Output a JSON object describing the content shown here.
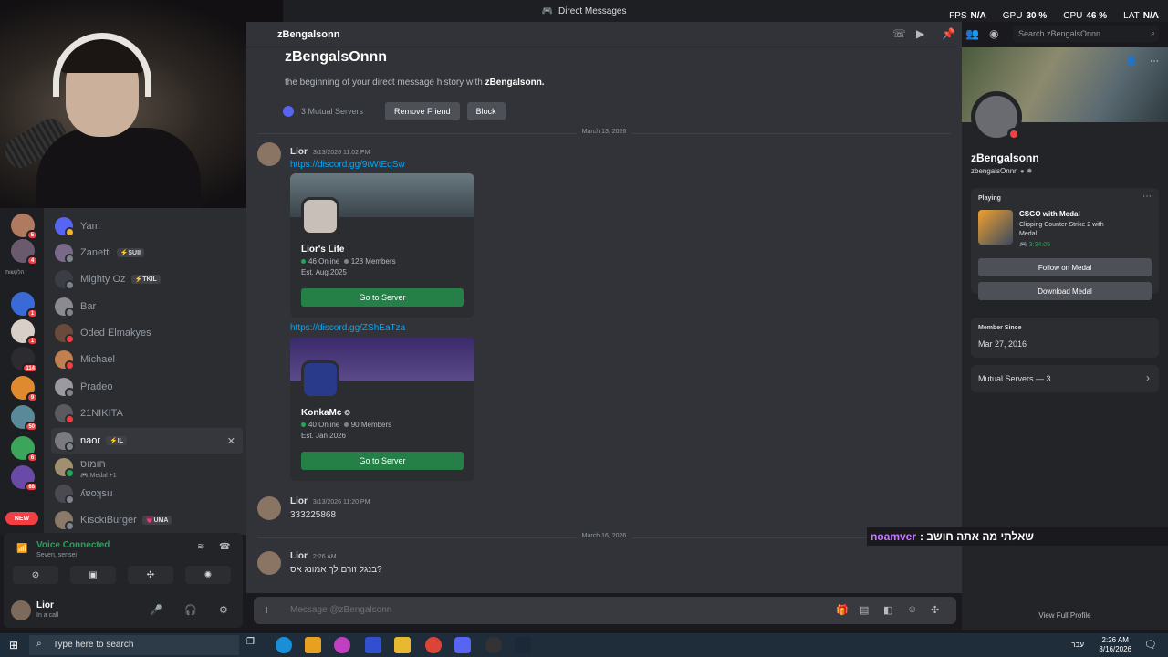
{
  "window": {
    "title": "Direct Messages"
  },
  "perf": [
    {
      "label": "FPS",
      "value": "N/A"
    },
    {
      "label": "GPU",
      "value": "30 %"
    },
    {
      "label": "CPU",
      "value": "46 %"
    },
    {
      "label": "LAT",
      "value": "N/A"
    }
  ],
  "rail": {
    "badges": [
      "5",
      "4",
      "1",
      "1",
      "114",
      "9",
      "50",
      "6",
      "68"
    ],
    "new_label": "NEW",
    "hebrew_label": "הלקשות"
  },
  "dm_list": [
    {
      "name": "Yam",
      "tag": "",
      "sub": ""
    },
    {
      "name": "Zanetti",
      "tag": "⚡SUII",
      "sub": ""
    },
    {
      "name": "Mighty Oz",
      "tag": "⚡TKIL",
      "sub": ""
    },
    {
      "name": "Bar",
      "tag": "",
      "sub": ""
    },
    {
      "name": "Oded Elmakyes",
      "tag": "",
      "sub": ""
    },
    {
      "name": "Michael",
      "tag": "",
      "sub": ""
    },
    {
      "name": "Pradeo",
      "tag": "",
      "sub": ""
    },
    {
      "name": "21NIKITA",
      "tag": "",
      "sub": ""
    },
    {
      "name": "naor",
      "tag": "⚡IL",
      "sub": ""
    },
    {
      "name": "חומוס",
      "tag": "",
      "sub": "🎮 Medal +1"
    },
    {
      "name": "ʎɐoʞsıɹ",
      "tag": "",
      "sub": ""
    },
    {
      "name": "KisckiBurger",
      "tag": "💗UMA",
      "sub": ""
    }
  ],
  "voice": {
    "status": "Voice Connected",
    "channel": "Seven, sensei"
  },
  "user": {
    "name": "Lior",
    "status": "In a call"
  },
  "chat": {
    "header_name": "zBengalsonn",
    "intro_name": "zBengalsOnnn",
    "intro_prefix": "the beginning of your direct message history with",
    "intro_user": "zBengalsonn.",
    "mutual_servers": "3 Mutual Servers",
    "remove_friend": "Remove Friend",
    "block": "Block",
    "search_placeholder": "Search zBengalsOnnn",
    "date1": "March 13, 2026",
    "date2": "March 16, 2026",
    "input_placeholder": "Message @zBengalsonn"
  },
  "messages": [
    {
      "author": "Lior",
      "time": "3/13/2026 11:02 PM",
      "link1": "https://discord.gg/9tWtEqSw",
      "link2": "https://discord.gg/ZShEaTza"
    },
    {
      "author": "Lior",
      "time": "3/13/2026 11:20 PM",
      "text": "333225868"
    },
    {
      "author": "Lior",
      "time": "2:26 AM",
      "text": "בנגל זורם לך אמונג אס?"
    }
  ],
  "invites": [
    {
      "name": "Lior's Life",
      "online": "46 Online",
      "members": "128 Members",
      "est": "Est. Aug 2025",
      "button": "Go to Server"
    },
    {
      "name": "KonkaMc",
      "online": "40 Online",
      "members": "90 Members",
      "est": "Est. Jan 2026",
      "button": "Go to Server"
    }
  ],
  "profile": {
    "display_name": "zBengalsonn",
    "username": "zbengalsOnnn",
    "playing_label": "Playing",
    "game_title": "CSGO with Medal",
    "game_desc": "Clipping Counter-Strike 2 with Medal",
    "game_time": "🎮 3:34:05",
    "follow_btn": "Follow on Medal",
    "download_btn": "Download Medal",
    "member_since_label": "Member Since",
    "member_since": "Mar 27, 2016",
    "mutual_servers": "Mutual Servers — 3",
    "view_full": "View Full Profile"
  },
  "stream_overlay": {
    "user": "noamver",
    "text": ": שאלתי מה אתה חושב"
  },
  "taskbar": {
    "search_placeholder": "Type here to search",
    "lang": "עבר",
    "time": "2:26 AM",
    "date": "3/16/2026"
  }
}
